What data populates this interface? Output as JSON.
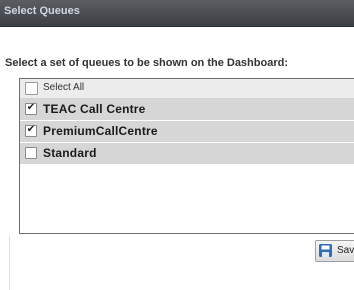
{
  "dialog": {
    "title": "Select Queues",
    "instructions": "Select a set of queues to be shown on the Dashboard:"
  },
  "queue_list": {
    "select_all_label": "Select All",
    "select_all_checked": false,
    "items": [
      {
        "label": "TEAC Call Centre",
        "checked": true
      },
      {
        "label": "PremiumCallCentre",
        "checked": true
      },
      {
        "label": "Standard",
        "checked": false
      }
    ]
  },
  "buttons": {
    "save_label": "Sav"
  },
  "glyphs": {
    "checkmark": "✔"
  },
  "colors": {
    "titlebar": "#4a4e52",
    "row_bg": "#d6d6d6",
    "save_icon": "#2f6fb6"
  }
}
